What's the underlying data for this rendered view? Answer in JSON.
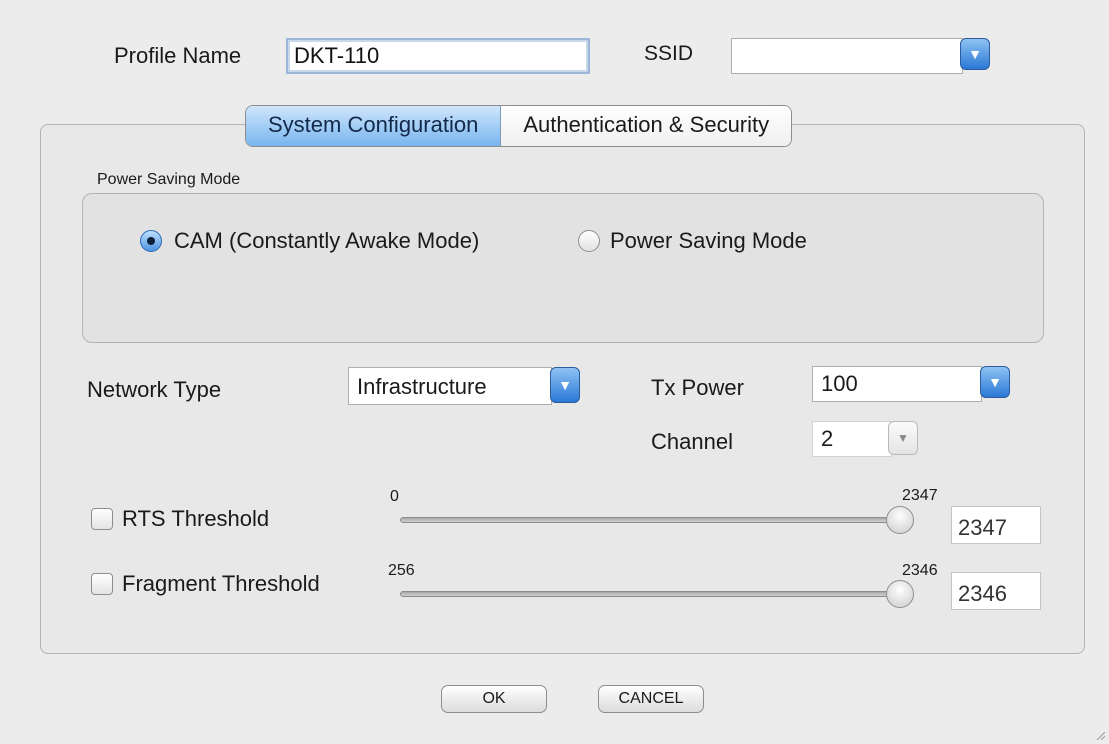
{
  "header": {
    "profile_name_label": "Profile Name",
    "profile_name_value": "DKT-110",
    "ssid_label": "SSID",
    "ssid_value": ""
  },
  "tabs": [
    {
      "label": "System Configuration",
      "active": true
    },
    {
      "label": "Authentication & Security",
      "active": false
    }
  ],
  "power_saving": {
    "group_label": "Power Saving Mode",
    "options": [
      {
        "label": "CAM (Constantly Awake Mode)",
        "selected": true
      },
      {
        "label": "Power Saving Mode",
        "selected": false
      }
    ]
  },
  "network": {
    "network_type_label": "Network Type",
    "network_type_value": "Infrastructure",
    "tx_power_label": "Tx Power",
    "tx_power_value": "100",
    "channel_label": "Channel",
    "channel_value": "2"
  },
  "rts": {
    "label": "RTS Threshold",
    "checked": false,
    "min_label": "0",
    "max_label": "2347",
    "value": "2347",
    "slider_fraction": 1.0
  },
  "fragment": {
    "label": "Fragment Threshold",
    "checked": false,
    "min_label": "256",
    "max_label": "2346",
    "value": "2346",
    "slider_fraction": 1.0
  },
  "buttons": {
    "ok": "OK",
    "cancel": "CANCEL"
  },
  "colors": {
    "accent": "#4c93e0",
    "window_bg": "#ececec"
  }
}
